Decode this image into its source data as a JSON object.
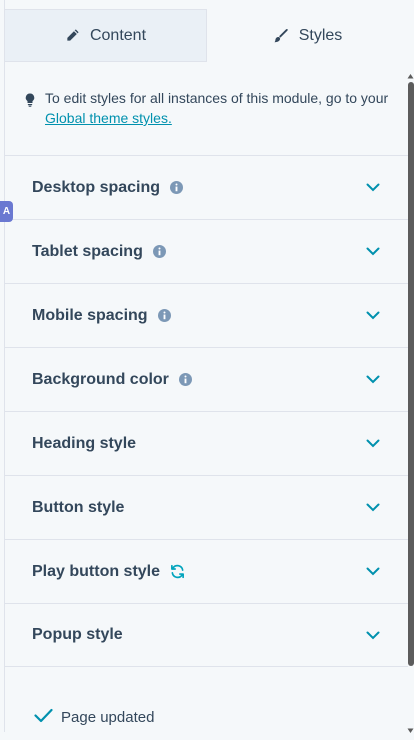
{
  "tabs": {
    "content": {
      "label": "Content",
      "icon": "pencil-icon"
    },
    "styles": {
      "label": "Styles",
      "icon": "brush-icon",
      "active": true
    }
  },
  "notice": {
    "text": "To edit styles for all instances of this module, go to your ",
    "link": "Global theme styles."
  },
  "sections": [
    {
      "label": "Desktop spacing",
      "info": true
    },
    {
      "label": "Tablet spacing",
      "info": true
    },
    {
      "label": "Mobile spacing",
      "info": true
    },
    {
      "label": "Background color",
      "info": true
    },
    {
      "label": "Heading style",
      "info": false
    },
    {
      "label": "Button style",
      "info": false
    },
    {
      "label": "Play button style",
      "sync": true
    },
    {
      "label": "Popup style",
      "info": false
    }
  ],
  "footer": {
    "status": "Page updated"
  },
  "edge_badge": "A",
  "colors": {
    "accent": "#0091ae",
    "text": "#33475b",
    "info_icon": "#7c98b6",
    "badge": "#6a78d1"
  }
}
